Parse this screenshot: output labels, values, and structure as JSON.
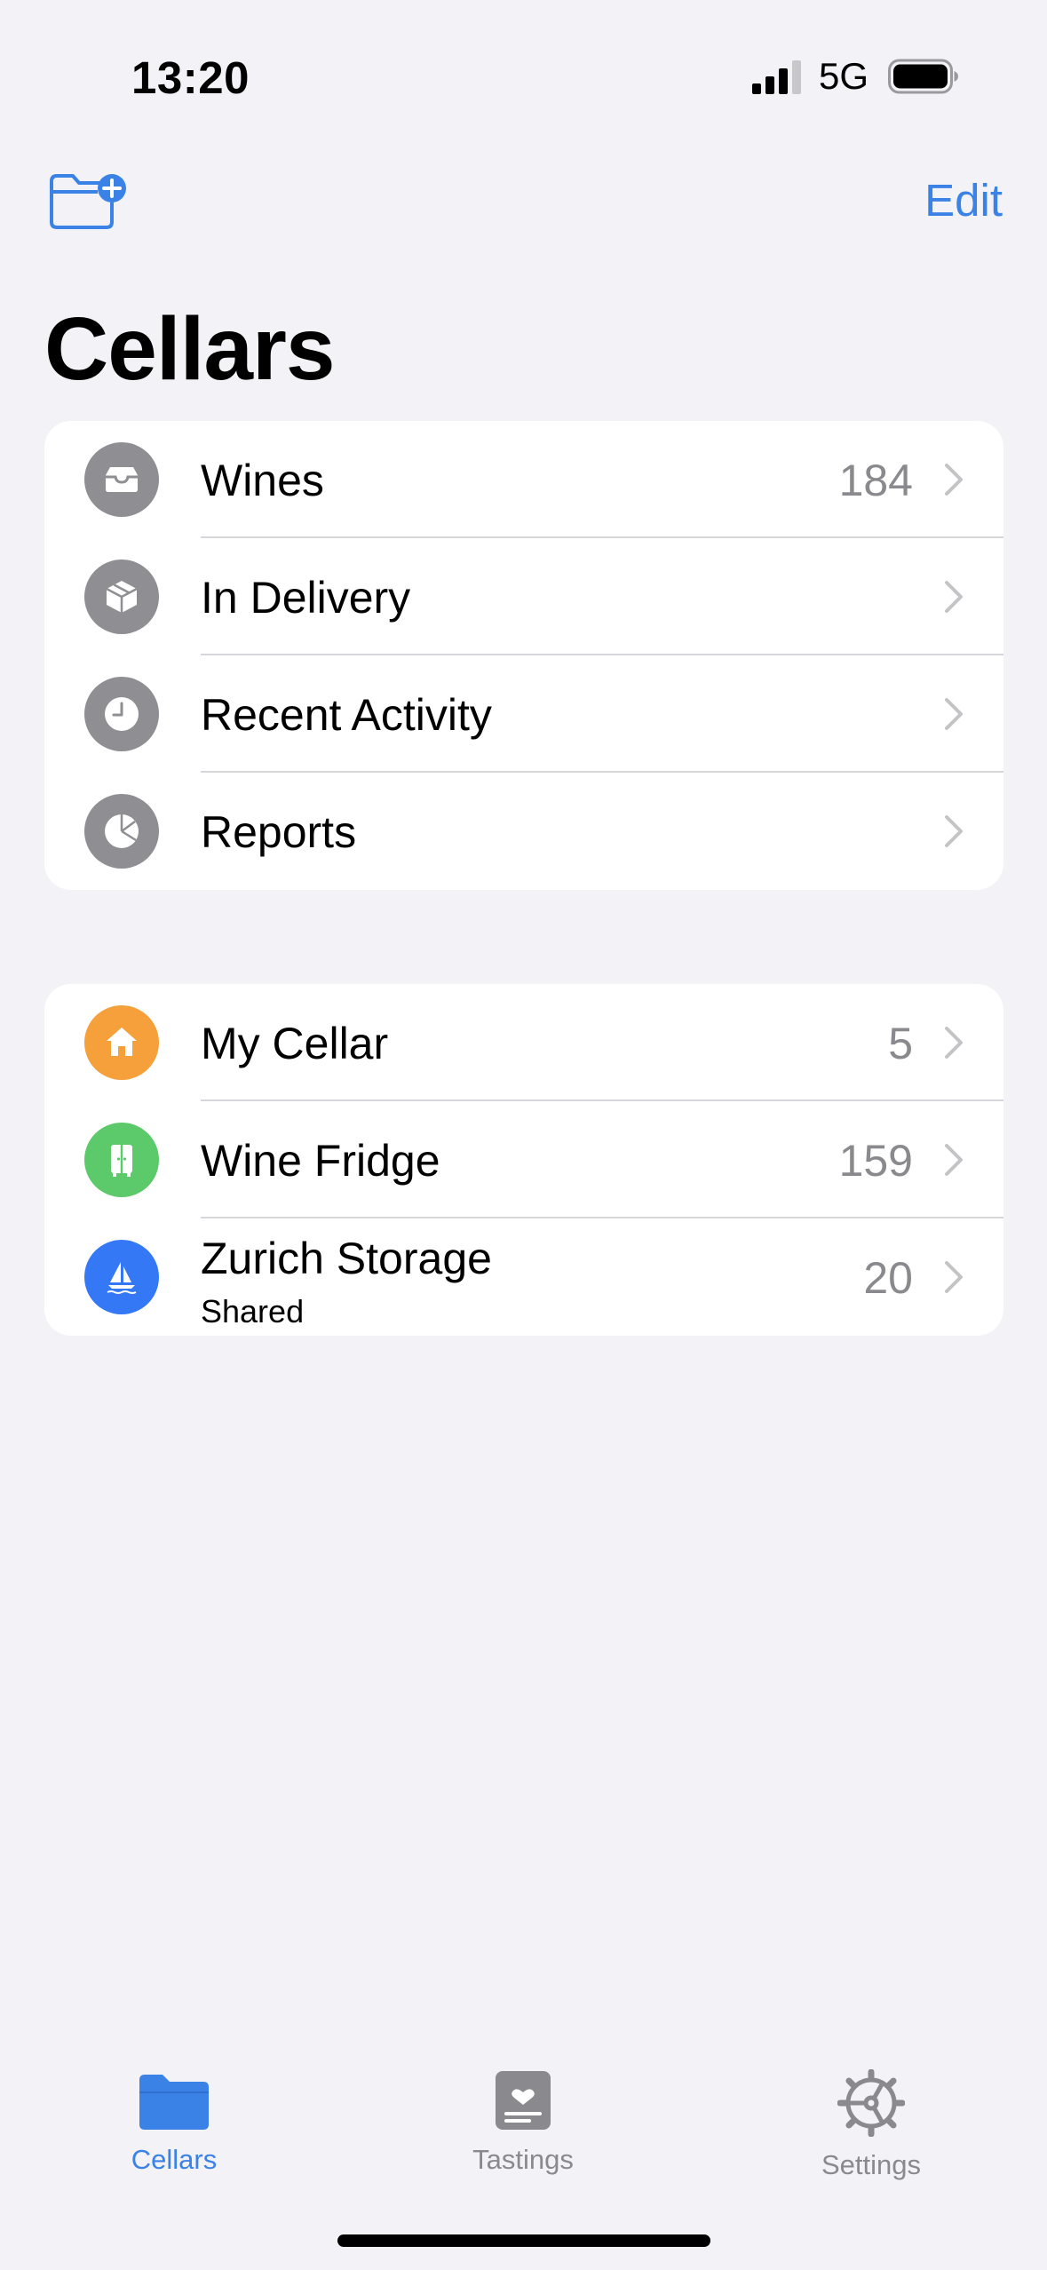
{
  "status_bar": {
    "time": "13:20",
    "network": "5G"
  },
  "nav": {
    "edit_label": "Edit",
    "new_folder_icon": "folder-badge-plus-icon"
  },
  "title": "Cellars",
  "group1": [
    {
      "label": "Wines",
      "count": "184",
      "icon": "tray-icon"
    },
    {
      "label": "In Delivery",
      "count": "",
      "icon": "shipping-box-icon"
    },
    {
      "label": "Recent Activity",
      "count": "",
      "icon": "clock-icon"
    },
    {
      "label": "Reports",
      "count": "",
      "icon": "pie-chart-icon"
    }
  ],
  "group2": [
    {
      "label": "My Cellar",
      "count": "5",
      "icon": "house-icon"
    },
    {
      "label": "Wine Fridge",
      "count": "159",
      "icon": "fridge-icon"
    },
    {
      "label": "Zurich Storage",
      "subtitle": "Shared",
      "count": "20",
      "icon": "sailboat-icon"
    }
  ],
  "tabs": [
    {
      "label": "Cellars",
      "icon": "folder-icon",
      "selected": true
    },
    {
      "label": "Tastings",
      "icon": "tasting-note-icon",
      "selected": false
    },
    {
      "label": "Settings",
      "icon": "gear-icon",
      "selected": false
    }
  ],
  "colors": {
    "accent": "#3b82e6",
    "background": "#f2f2f7",
    "gray_icon": "#8e8e93",
    "orange_icon": "#f5a03a",
    "green_icon": "#5cc96a",
    "blue_icon": "#3478f6"
  }
}
